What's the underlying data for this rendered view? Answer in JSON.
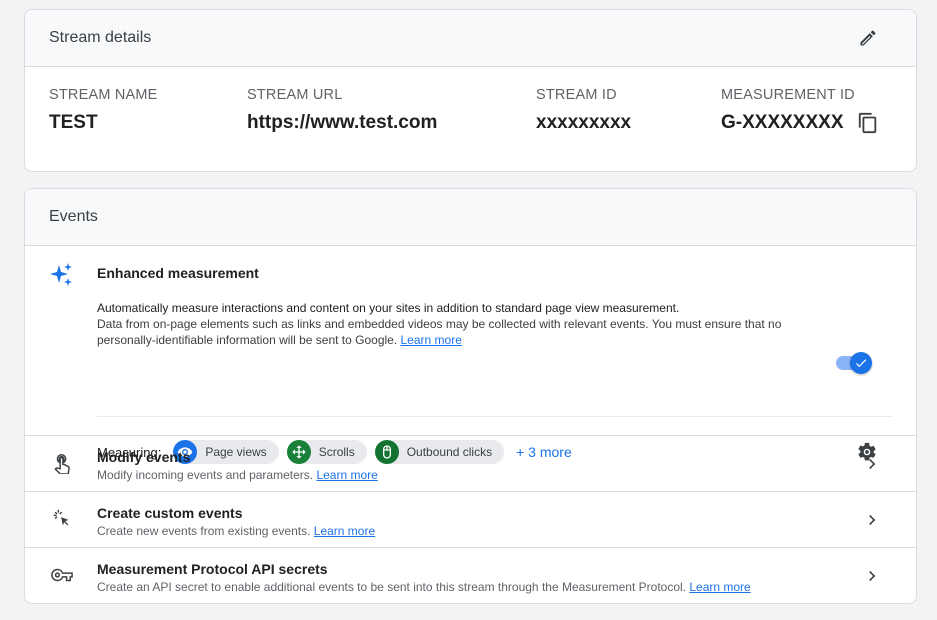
{
  "stream_details": {
    "title": "Stream details",
    "fields": [
      {
        "label": "STREAM NAME",
        "value": "TEST"
      },
      {
        "label": "STREAM URL",
        "value": "https://www.test.com"
      },
      {
        "label": "STREAM ID",
        "value": "xxxxxxxxx"
      },
      {
        "label": "MEASUREMENT ID",
        "value": "G-XXXXXXXX"
      }
    ],
    "edit_icon": "pencil-icon",
    "copy_icon": "copy-icon"
  },
  "events": {
    "title": "Events",
    "enhanced": {
      "title": "Enhanced measurement",
      "line1": "Automatically measure interactions and content on your sites in addition to standard page view measurement.",
      "line2": "Data from on-page elements such as links and embedded videos may be collected with relevant events. You must ensure that no personally-identifiable information will be sent to Google. ",
      "learn_more": "Learn more",
      "toggle_on": true,
      "measuring_label": "Measuring:",
      "chips": [
        {
          "label": "Page views",
          "icon": "eye-icon",
          "color": "#1a73e8"
        },
        {
          "label": "Scrolls",
          "icon": "scroll-arrows-icon",
          "color": "#188038"
        },
        {
          "label": "Outbound clicks",
          "icon": "mouse-icon",
          "color": "#137333"
        }
      ],
      "more": "+ 3 more"
    },
    "rows": [
      {
        "title": "Modify events",
        "desc": "Modify incoming events and parameters. ",
        "learn_more": "Learn more"
      },
      {
        "title": "Create custom events",
        "desc": "Create new events from existing events. ",
        "learn_more": "Learn more"
      },
      {
        "title": "Measurement Protocol API secrets",
        "desc": "Create an API secret to enable additional events to be sent into this stream through the Measurement Protocol. ",
        "learn_more": "Learn more"
      }
    ]
  },
  "colors": {
    "accent": "#1a73e8",
    "scroll_chip": "#188038",
    "outbound_chip": "#137333"
  }
}
